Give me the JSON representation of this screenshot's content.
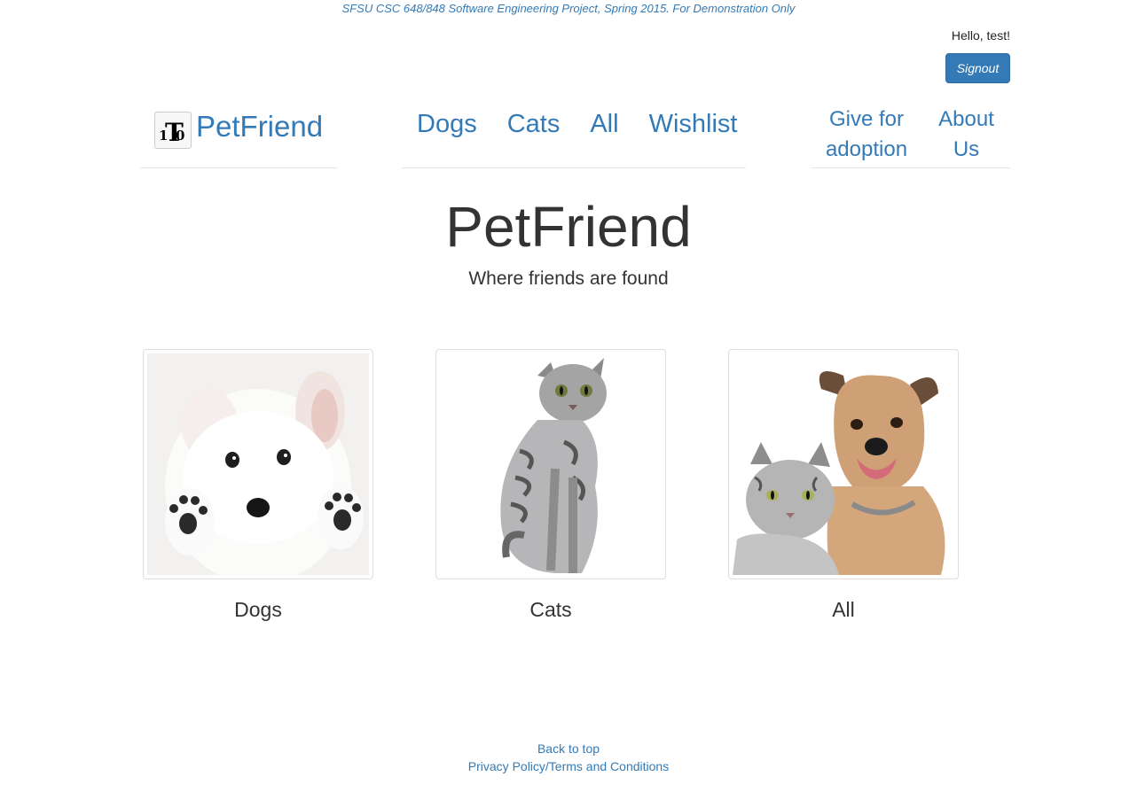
{
  "disclaimer": "SFSU CSC 648/848 Software Engineering Project, Spring 2015. For Demonstration Only",
  "user": {
    "greeting": "Hello, test!",
    "signout_label": "Signout"
  },
  "brand": {
    "logo_text": "1T0",
    "name": "PetFriend"
  },
  "nav": {
    "main": [
      {
        "label": "Dogs"
      },
      {
        "label": "Cats"
      },
      {
        "label": "All"
      },
      {
        "label": "Wishlist"
      }
    ],
    "give_for_adoption_line1": "Give for",
    "give_for_adoption_line2": "adoption",
    "about_us_line1": "About",
    "about_us_line2": "Us"
  },
  "hero": {
    "title": "PetFriend",
    "subtitle": "Where friends are found"
  },
  "categories": [
    {
      "label": "Dogs",
      "image": "white-puppy-photo"
    },
    {
      "label": "Cats",
      "image": "tabby-cat-photo"
    },
    {
      "label": "All",
      "image": "cat-and-dog-photo"
    }
  ],
  "footer": {
    "back_to_top": "Back to top",
    "privacy": "Privacy Policy/Terms and Conditions"
  },
  "colors": {
    "link": "#337ab7",
    "button": "#337ab7",
    "text": "#333333",
    "divider": "#e5e5e5"
  }
}
